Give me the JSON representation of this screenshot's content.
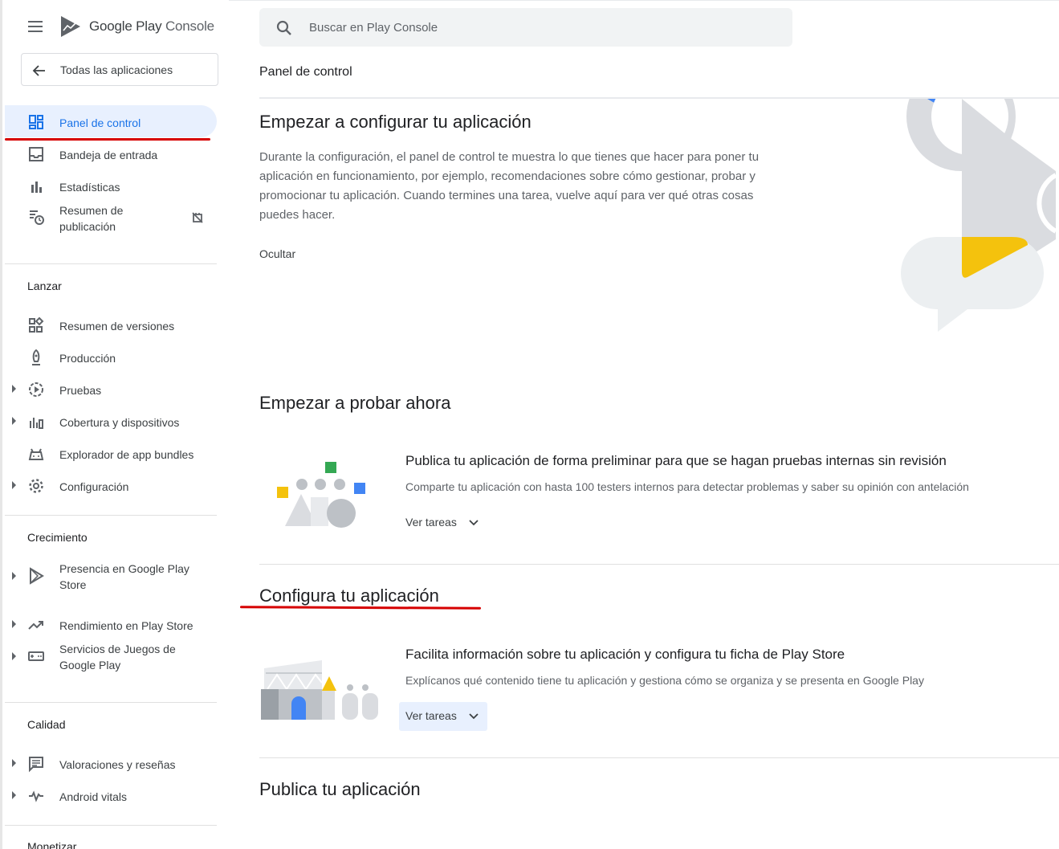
{
  "app": {
    "brand_primary": "Google Play",
    "brand_secondary": "Console"
  },
  "sidebar": {
    "all_apps_label": "Todas las aplicaciones",
    "items": [
      {
        "label": "Panel de control",
        "icon": "dashboard-icon",
        "active": true
      },
      {
        "label": "Bandeja de entrada",
        "icon": "inbox-icon"
      },
      {
        "label": "Estadísticas",
        "icon": "bar-chart-icon"
      },
      {
        "label": "Resumen de publicación",
        "icon": "publishing-overview-icon",
        "badge_icon": "sync-disabled-icon"
      }
    ],
    "sections": [
      {
        "title": "Lanzar",
        "items": [
          {
            "label": "Resumen de versiones",
            "icon": "releases-overview-icon"
          },
          {
            "label": "Producción",
            "icon": "production-icon"
          },
          {
            "label": "Pruebas",
            "icon": "testing-icon",
            "expandable": true
          },
          {
            "label": "Cobertura y dispositivos",
            "icon": "reach-devices-icon",
            "expandable": true
          },
          {
            "label": "Explorador de app bundles",
            "icon": "app-bundle-explorer-icon"
          },
          {
            "label": "Configuración",
            "icon": "settings-icon",
            "expandable": true
          }
        ]
      },
      {
        "title": "Crecimiento",
        "items": [
          {
            "label": "Presencia en Google Play Store",
            "icon": "store-presence-icon",
            "expandable": true
          },
          {
            "label": "Rendimiento en Play Store",
            "icon": "trending-up-icon",
            "expandable": true
          },
          {
            "label": "Servicios de Juegos de Google Play",
            "icon": "games-services-icon",
            "expandable": true
          }
        ]
      },
      {
        "title": "Calidad",
        "items": [
          {
            "label": "Valoraciones y reseñas",
            "icon": "ratings-reviews-icon",
            "expandable": true
          },
          {
            "label": "Android vitals",
            "icon": "vitals-icon",
            "expandable": true
          }
        ]
      },
      {
        "title": "Monetizar",
        "items": []
      }
    ]
  },
  "search": {
    "placeholder": "Buscar en Play Console"
  },
  "main": {
    "breadcrumb": "Panel de control",
    "setup_title": "Empezar a configurar tu aplicación",
    "setup_text": "Durante la configuración, el panel de control te muestra lo que tienes que hacer para poner tu aplicación en funcionamiento, por ejemplo, recomendaciones sobre cómo gestionar, probar y promocionar tu aplicación. Cuando termines una tarea, vuelve aquí para ver qué otras cosas puedes hacer.",
    "hide_label": "Ocultar",
    "testing_title": "Empezar a probar ahora",
    "testing_card": {
      "title": "Publica tu aplicación de forma preliminar para que se hagan pruebas internas sin revisión",
      "desc": "Comparte tu aplicación con hasta 100 testers internos para detectar problemas y saber su opinión con antelación",
      "action": "Ver tareas"
    },
    "configure_title": "Configura tu aplicación",
    "configure_card": {
      "title": "Facilita información sobre tu aplicación y configura tu ficha de Play Store",
      "desc": "Explícanos qué contenido tiene tu aplicación y gestiona cómo se organiza y se presenta en Google Play",
      "action": "Ver tareas"
    },
    "publish_title": "Publica tu aplicación"
  },
  "colors": {
    "accent_blue": "#1a73e8",
    "active_bg": "#e8f0fe",
    "annotation_red": "#d60000",
    "illustration_yellow": "#f4c20d",
    "illustration_green": "#34a853",
    "illustration_blue": "#4285f4"
  }
}
